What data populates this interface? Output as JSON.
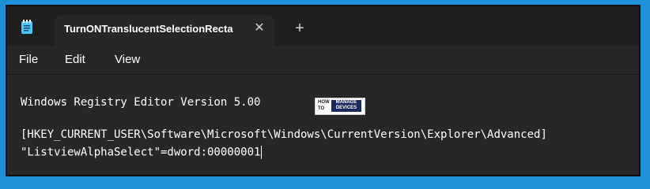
{
  "tab": {
    "title": "TurnONTranslucentSelectionRecta",
    "close_glyph": "✕"
  },
  "new_tab_glyph": "+",
  "menu": {
    "file": "File",
    "edit": "Edit",
    "view": "View"
  },
  "editor": {
    "line1": "Windows Registry Editor Version 5.00",
    "line2": "[HKEY_CURRENT_USER\\Software\\Microsoft\\Windows\\CurrentVersion\\Explorer\\Advanced]",
    "line3": "\"ListviewAlphaSelect\"=dword:00000001"
  },
  "watermark": {
    "left_top": "HOW",
    "left_bottom": "TO",
    "right_top": "MANAGE",
    "right_bottom": "DEVICES"
  },
  "colors": {
    "background": "#1e90d8",
    "window": "#272727",
    "titlebar": "#1f1f1f",
    "icon_accent": "#4fc3f7"
  },
  "icons": {
    "app": "notepad-icon",
    "close": "close-icon",
    "new_tab": "plus-icon"
  }
}
